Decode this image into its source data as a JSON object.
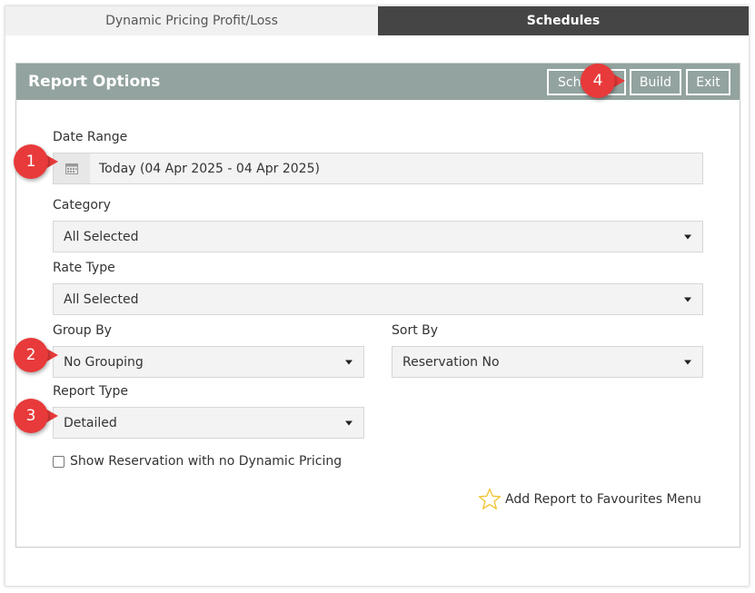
{
  "tabs": [
    {
      "label": "Dynamic Pricing Profit/Loss",
      "active": true
    },
    {
      "label": "Schedules",
      "active": false
    }
  ],
  "panel": {
    "title": "Report Options",
    "buttons": {
      "schedule": "Schedule",
      "build": "Build",
      "exit": "Exit"
    }
  },
  "form": {
    "date_range": {
      "label": "Date Range",
      "value": "Today (04 Apr 2025 - 04 Apr 2025)",
      "icon": "calendar-icon"
    },
    "category": {
      "label": "Category",
      "value": "All Selected"
    },
    "rate_type": {
      "label": "Rate Type",
      "value": "All Selected"
    },
    "group_by": {
      "label": "Group By",
      "value": "No Grouping"
    },
    "sort_by": {
      "label": "Sort By",
      "value": "Reservation No"
    },
    "report_type": {
      "label": "Report Type",
      "value": "Detailed"
    },
    "show_no_dynamic": {
      "label": "Show Reservation with no Dynamic Pricing",
      "checked": false
    }
  },
  "favourites": {
    "label": "Add Report to Favourites Menu",
    "icon": "star-outline-icon"
  },
  "markers": [
    "1",
    "2",
    "3",
    "4"
  ],
  "colors": {
    "header": "#93a39f",
    "tab_dark": "#454545",
    "marker": "#e83a3a",
    "star": "#f2c230"
  }
}
